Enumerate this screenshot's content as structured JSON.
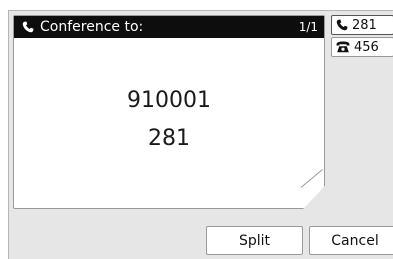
{
  "title_bar": {
    "title": "Conference to:",
    "page_indicator": "1/1"
  },
  "main": {
    "numbers": [
      "910001",
      "281"
    ]
  },
  "call_list": [
    {
      "label": "281",
      "icon": "handset-icon",
      "selected": true
    },
    {
      "label": "456",
      "icon": "desk-phone-icon",
      "selected": false
    }
  ],
  "softkeys": {
    "split_label": "Split",
    "cancel_label": "Cancel"
  },
  "colors": {
    "title_bar_bg": "#0d0d0d",
    "screen_bg": "#e6e6e6",
    "panel_bg": "#ffffff"
  }
}
